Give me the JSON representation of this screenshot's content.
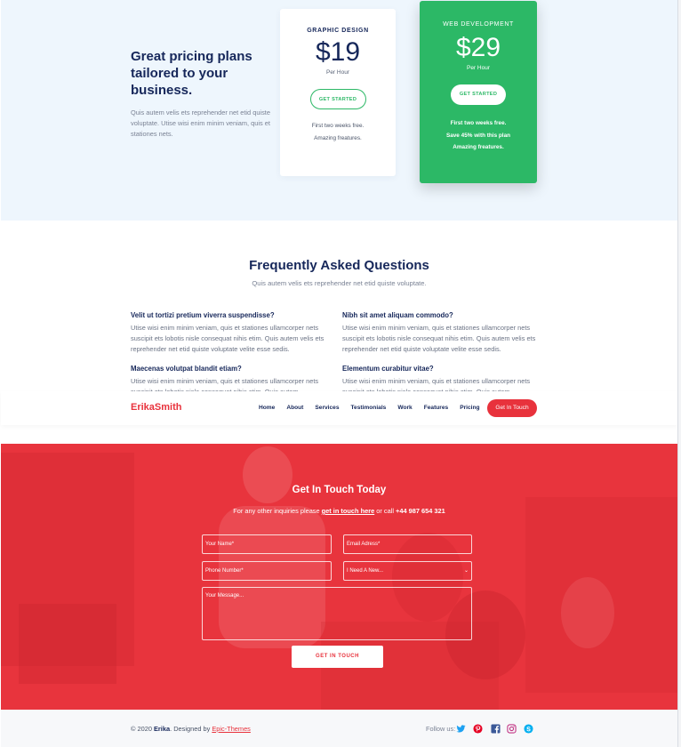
{
  "pricing": {
    "heading": "Great pricing plans tailored to your business.",
    "text": "Quis autem velis ets reprehender net etid quiste voluptate. Utise wisi enim minim veniam, quis et stationes nets.",
    "plans": [
      {
        "name": "GRAPHIC DESIGN",
        "price": "$19",
        "unit": "Per Hour",
        "button": "GET STARTED",
        "features": [
          "First two weeks free.",
          "Amazing freatures."
        ]
      },
      {
        "name": "WEB DEVELOPMENT",
        "price": "$29",
        "unit": "Per Hour",
        "button": "GET STARTED",
        "features": [
          "First two weeks free.",
          "Save 45% with this plan",
          "Amazing freatures."
        ]
      }
    ]
  },
  "faq": {
    "title": "Frequently Asked Questions",
    "subtitle": "Quis autem velis ets reprehender net etid quiste voluptate.",
    "items": [
      {
        "q": "Velit ut tortizi pretium viverra suspendisse?",
        "a": "Utise wisi enim minim veniam, quis et stationes ullamcorper nets suscipit ets lobotis nisle consequat nihis etim. Quis autem velis ets reprehender net etid quiste voluptate velite esse sedis."
      },
      {
        "q": "Nibh sit amet aliquam commodo?",
        "a": "Utise wisi enim minim veniam, quis et stationes ullamcorper nets suscipit ets lobotis nisle consequat nihis etim. Quis autem velis ets reprehender net etid quiste voluptate velite esse sedis."
      },
      {
        "q": "Maecenas volutpat blandit etiam?",
        "a": "Utise wisi enim minim veniam, quis et stationes ullamcorper nets suscipit ets lobotis nisle consequat nihis etim. Quis autem"
      },
      {
        "q": "Elementum curabitur vitae?",
        "a": "Utise wisi enim minim veniam, quis et stationes ullamcorper nets suscipit ets lobotis nisle consequat nihis etim. Quis autem"
      }
    ]
  },
  "navbar": {
    "brand": "ErikaSmith",
    "links": [
      "Home",
      "About",
      "Services",
      "Testimonials",
      "Work",
      "Features",
      "Pricing"
    ],
    "cta": "Get In Touch"
  },
  "contact": {
    "title": "Get In Touch Today",
    "sub_prefix": "For any other inquiries please ",
    "sub_link": "get in touch here",
    "sub_middle": " or call ",
    "sub_phone": "+44 987 654 321",
    "name_placeholder": "Your Name*",
    "email_placeholder": "Email Adress*",
    "phone_placeholder": "Phone Number*",
    "select_value": "I Need A New...",
    "message_placeholder": "Your Message...",
    "submit": "GET IN TOUCH"
  },
  "footer": {
    "copyright_prefix": "© 2020 ",
    "copyright_name": "Erika",
    "copyright_mid": ". Designed by ",
    "credit": "Epic-Themes",
    "follow": "Follow us:",
    "social_icons": [
      "twitter-icon",
      "pinterest-icon",
      "facebook-icon",
      "instagram-icon",
      "skype-icon"
    ]
  },
  "colors": {
    "accent_red": "#e8323c",
    "accent_green": "#2cb866",
    "navy": "#16275a",
    "pricing_bg": "#eef6fd"
  }
}
